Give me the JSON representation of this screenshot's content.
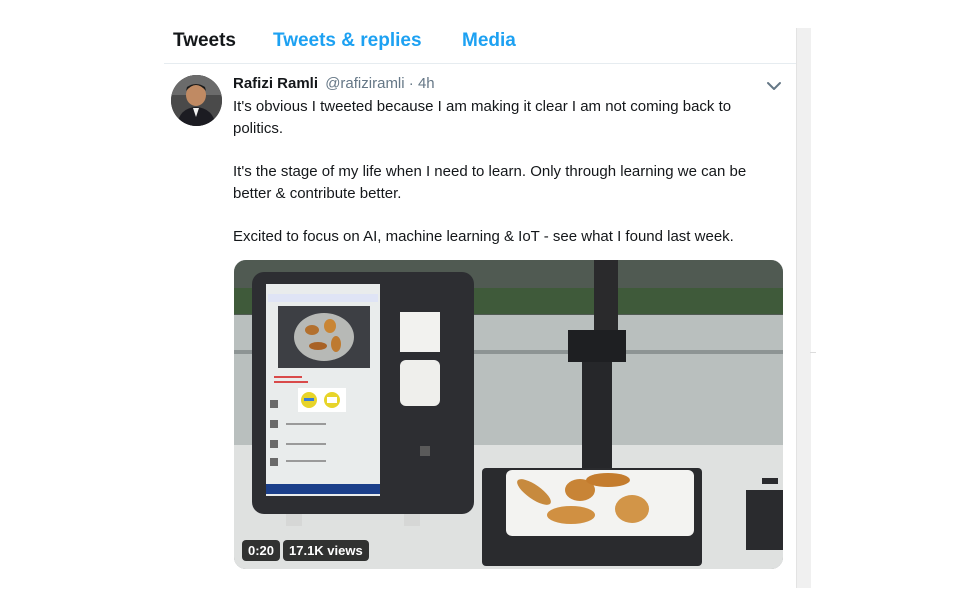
{
  "tabs": [
    {
      "label": "Tweets",
      "active": true
    },
    {
      "label": "Tweets & replies",
      "active": false
    },
    {
      "label": "Media",
      "active": false
    }
  ],
  "tweet": {
    "author_name": "Rafizi Ramli",
    "handle": "@rafiziramli",
    "separator": "·",
    "time": "4h",
    "paragraphs": [
      "It's obvious I tweeted because I am making it clear I am not coming back to politics.",
      "It's the stage of my life when I need to learn. Only through learning we can be better & contribute better.",
      "Excited to focus on AI, machine learning & IoT - see what I found last week."
    ],
    "video": {
      "duration": "0:20",
      "views": "17.1K views"
    }
  },
  "icons": {
    "menu": "chevron-down-icon"
  },
  "colors": {
    "accent": "#1da1f2",
    "text": "#14171a",
    "muted": "#657786"
  }
}
